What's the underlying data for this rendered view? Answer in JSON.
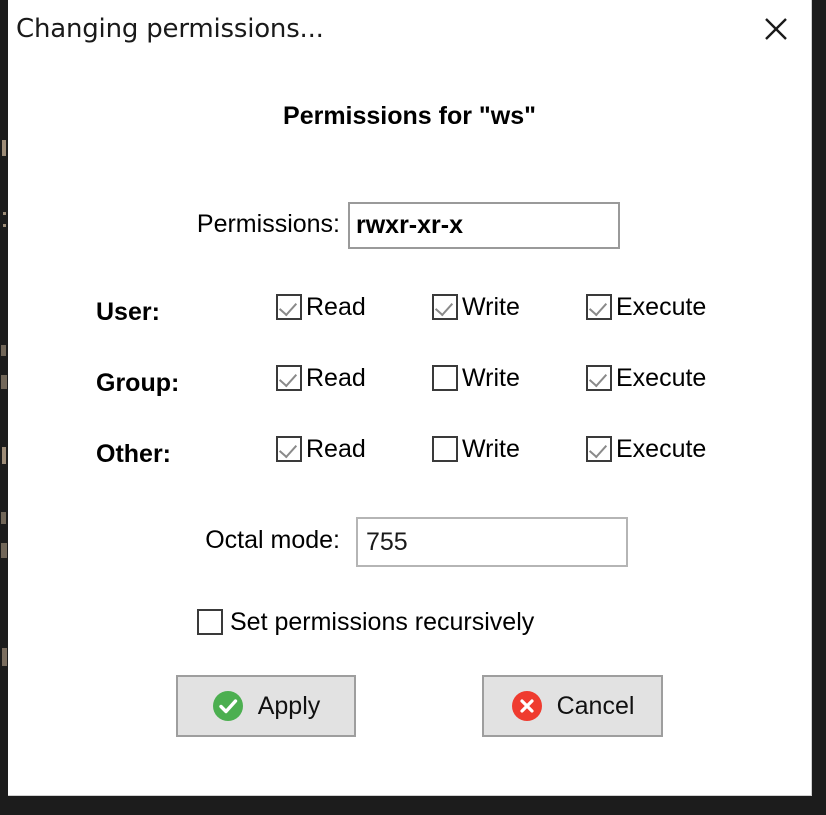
{
  "window": {
    "title": "Changing permissions...",
    "close_icon": "close-x-icon"
  },
  "dialog": {
    "heading": "Permissions for \"ws\"",
    "permissions_field": {
      "label": "Permissions:",
      "value": "rwxr-xr-x",
      "placeholder": ""
    },
    "matrix": {
      "rows": [
        {
          "label": "User:",
          "boxes": [
            {
              "label": "Read",
              "checked": true
            },
            {
              "label": "Write",
              "checked": true
            },
            {
              "label": "Execute",
              "checked": true
            }
          ]
        },
        {
          "label": "Group:",
          "boxes": [
            {
              "label": "Read",
              "checked": true
            },
            {
              "label": "Write",
              "checked": false
            },
            {
              "label": "Execute",
              "checked": true
            }
          ]
        },
        {
          "label": "Other:",
          "boxes": [
            {
              "label": "Read",
              "checked": true
            },
            {
              "label": "Write",
              "checked": false
            },
            {
              "label": "Execute",
              "checked": true
            }
          ]
        }
      ]
    },
    "octal_field": {
      "label": "Octal mode:",
      "value": "755",
      "placeholder": ""
    },
    "recursive": {
      "label": "Set permissions recursively",
      "checked": false
    },
    "buttons": {
      "apply": {
        "label": "Apply",
        "icon": "check-circle-icon"
      },
      "cancel": {
        "label": "Cancel",
        "icon": "x-circle-icon"
      }
    }
  },
  "colors": {
    "apply_green": "#4caf50",
    "cancel_red": "#ef3b2f",
    "dialog_bg": "#ffffff",
    "button_bg": "#e2e2e2",
    "desktop_bg": "#1c1c1c",
    "check_gray": "#8a8a8a"
  }
}
